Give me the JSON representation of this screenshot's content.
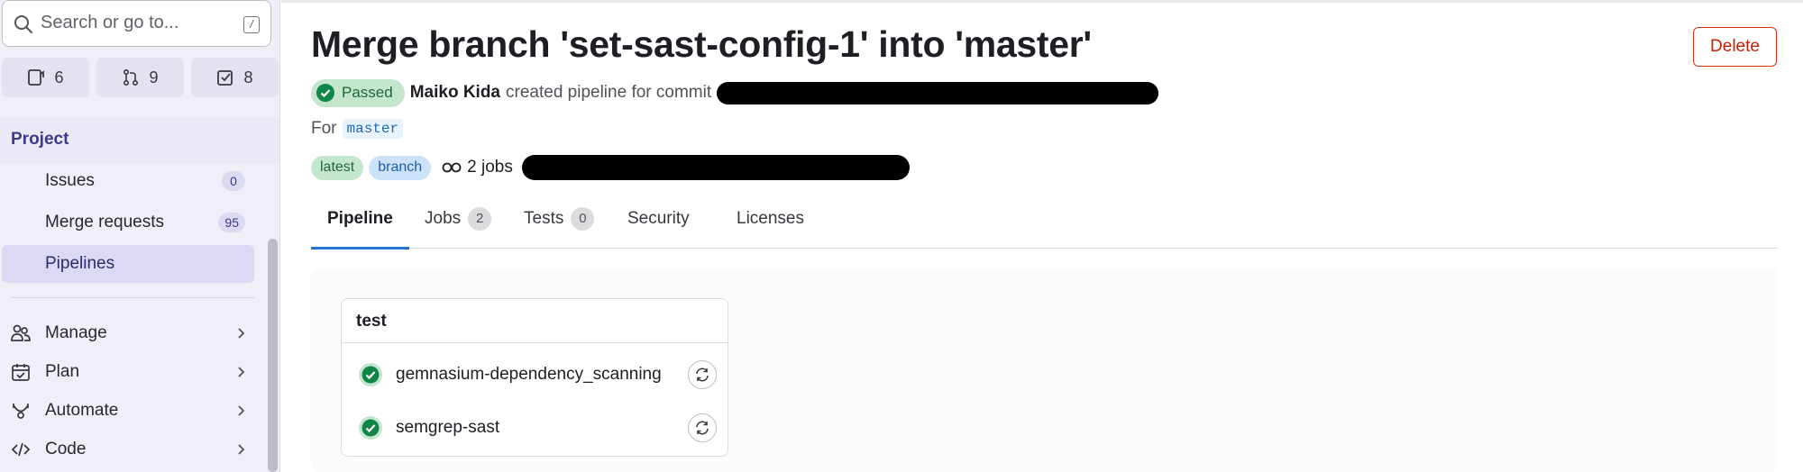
{
  "sidebar": {
    "search": {
      "placeholder": "Search or go to...",
      "shortcut": "/"
    },
    "counts": [
      {
        "icon": "issues-icon",
        "value": "6"
      },
      {
        "icon": "merge-request-icon",
        "value": "9"
      },
      {
        "icon": "todo-icon",
        "value": "8"
      }
    ],
    "section_title": "Project",
    "items": [
      {
        "label": "Issues",
        "badge": "0"
      },
      {
        "label": "Merge requests",
        "badge": "95"
      },
      {
        "label": "Pipelines",
        "active": true
      }
    ],
    "groups": [
      {
        "label": "Manage",
        "icon": "users-icon"
      },
      {
        "label": "Plan",
        "icon": "calendar-icon"
      },
      {
        "label": "Automate",
        "icon": "rocket-icon"
      },
      {
        "label": "Code",
        "icon": "code-icon"
      }
    ]
  },
  "header": {
    "title": "Merge branch 'set-sast-config-1' into 'master'",
    "delete_label": "Delete",
    "status": "Passed",
    "author": "Maiko Kida",
    "action_text": "created pipeline for commit",
    "for_label": "For",
    "branch": "master",
    "tags": [
      "latest",
      "branch"
    ],
    "jobs_count_label": "2 jobs"
  },
  "tabs": [
    {
      "label": "Pipeline",
      "active": true
    },
    {
      "label": "Jobs",
      "count": "2"
    },
    {
      "label": "Tests",
      "count": "0"
    },
    {
      "label": "Security"
    },
    {
      "label": "Licenses"
    }
  ],
  "pipeline": {
    "stage": "test",
    "jobs": [
      {
        "name": "gemnasium-dependency_scanning",
        "status": "passed"
      },
      {
        "name": "semgrep-sast",
        "status": "passed"
      }
    ]
  },
  "colors": {
    "accent": "#1f75cb",
    "success": "#108548",
    "danger": "#dd2b0e",
    "sidebar_bg": "#f0eff8"
  }
}
